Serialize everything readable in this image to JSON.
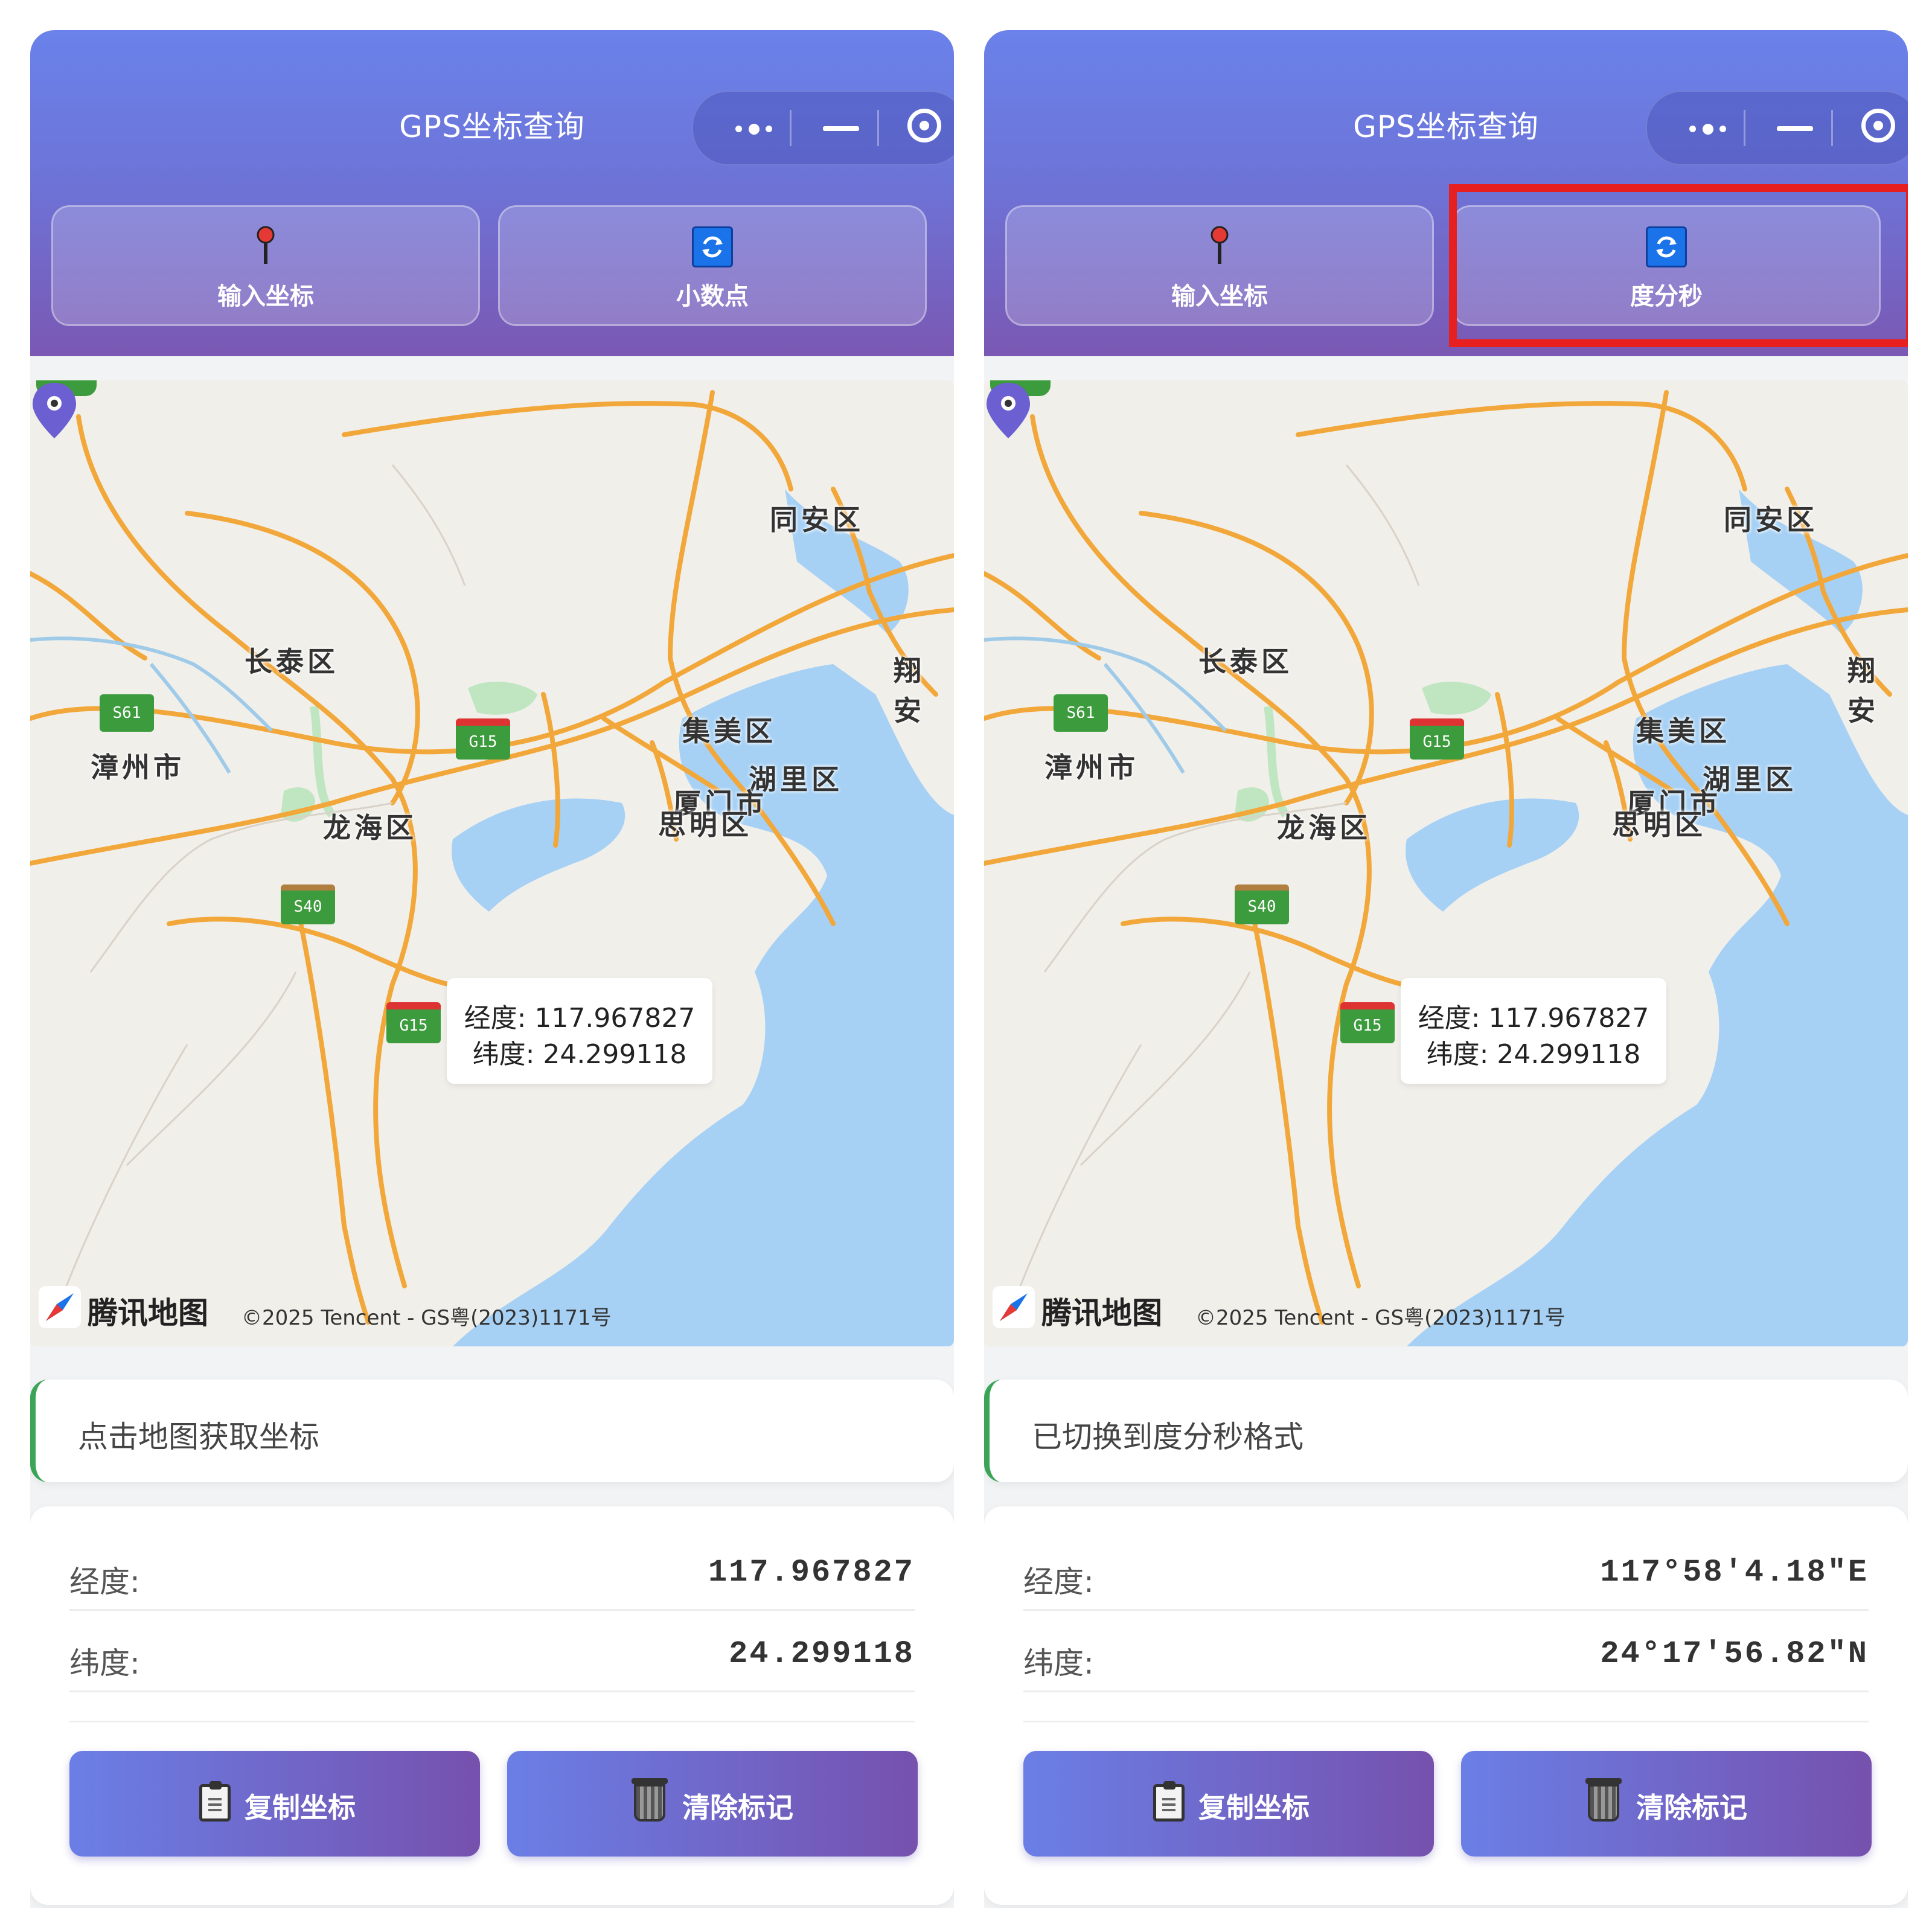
{
  "screens": [
    {
      "title": "GPS坐标查询",
      "mode_buttons": {
        "input_label": "输入坐标",
        "format_label": "小数点"
      },
      "map": {
        "places": [
          "同安区",
          "长泰区",
          "翔安",
          "集美区",
          "漳州市",
          "湖里区",
          "厦门市",
          "龙海区",
          "思明区"
        ],
        "shields": [
          "S61",
          "G15",
          "S40",
          "G15"
        ],
        "tooltip": {
          "lng_text": "经度: 117.967827",
          "lat_text": "纬度: 24.299118"
        },
        "logo_text": "腾讯地图",
        "copyright": "©2025 Tencent - GS粤(2023)1171号"
      },
      "status": "点击地图获取坐标",
      "coords": {
        "lng_label": "经度:",
        "lng_value": "117.967827",
        "lat_label": "纬度:",
        "lat_value": "24.299118"
      },
      "actions": {
        "copy_label": "复制坐标",
        "clear_label": "清除标记"
      }
    },
    {
      "title": "GPS坐标查询",
      "mode_buttons": {
        "input_label": "输入坐标",
        "format_label": "度分秒"
      },
      "map": {
        "places": [
          "同安区",
          "长泰区",
          "翔安",
          "集美区",
          "漳州市",
          "湖里区",
          "厦门市",
          "龙海区",
          "思明区"
        ],
        "shields": [
          "S61",
          "G15",
          "S40",
          "G15"
        ],
        "tooltip": {
          "lng_text": "经度: 117.967827",
          "lat_text": "纬度: 24.299118"
        },
        "logo_text": "腾讯地图",
        "copyright": "©2025 Tencent - GS粤(2023)1171号"
      },
      "status": "已切换到度分秒格式",
      "coords": {
        "lng_label": "经度:",
        "lng_value": "117°58'4.18\"E",
        "lat_label": "纬度:",
        "lat_value": "24°17'56.82\"N"
      },
      "actions": {
        "copy_label": "复制坐标",
        "clear_label": "清除标记"
      }
    }
  ],
  "colors": {
    "header_start": "#6a82ea",
    "header_end": "#7a58b3",
    "status_accent": "#3aa556",
    "highlight": "#e81f1f",
    "marker": "#6c5fd1"
  },
  "icons": {
    "more": "more-dots-icon",
    "minimize": "minimize-icon",
    "close": "target-close-icon",
    "pin": "pushpin-icon",
    "refresh": "refresh-icon",
    "clipboard": "clipboard-icon",
    "trash": "trash-icon",
    "marker": "map-marker-icon"
  }
}
